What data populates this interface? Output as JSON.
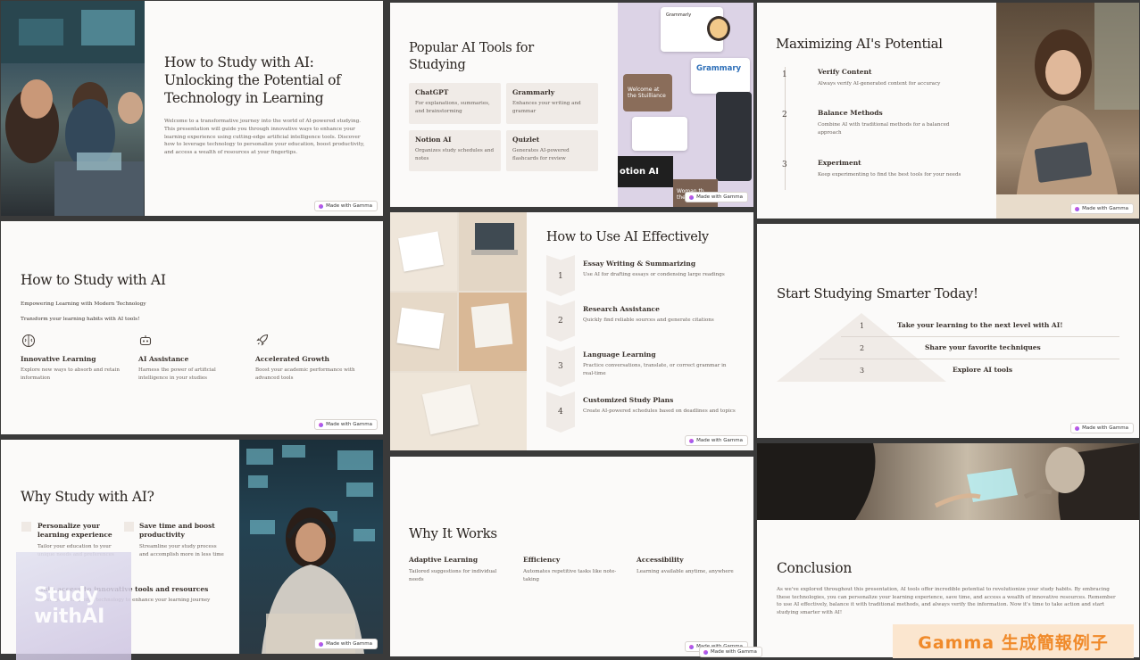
{
  "badge": "Made with Gamma",
  "slide1": {
    "title_lines": [
      "How to Study with AI:",
      "Unlocking the Potential of",
      "Technology in Learning"
    ],
    "body": "Welcome to a transformative journey into the world of AI-powered studying. This presentation will guide you through innovative ways to enhance your learning experience using cutting-edge artificial intelligence tools. Discover how to leverage technology to personalize your education, boost productivity, and access a wealth of resources at your fingertips."
  },
  "slide2": {
    "title": "Popular AI Tools for Studying",
    "tools": [
      {
        "name": "ChatGPT",
        "desc": "For explanations, summaries, and brainstorming"
      },
      {
        "name": "Grammarly",
        "desc": "Enhances your writing and grammar"
      },
      {
        "name": "Notion AI",
        "desc": "Organizes study schedules and notes"
      },
      {
        "name": "Quizlet",
        "desc": "Generates AI-powered flashcards for review"
      }
    ],
    "collage": {
      "grammarly_top": "Grammarly",
      "grammarly_main": "Grammary",
      "welcome": "Welcome at the Stuilliance",
      "notion": "otion AI",
      "woman": "Woman th the"
    }
  },
  "slide3": {
    "title": "Maximizing AI's Potential",
    "steps": [
      {
        "n": "1",
        "name": "Verify Content",
        "desc": "Always verify AI-generated content for accuracy"
      },
      {
        "n": "2",
        "name": "Balance Methods",
        "desc": "Combine AI with traditional methods for a balanced approach"
      },
      {
        "n": "3",
        "name": "Experiment",
        "desc": "Keep experimenting to find the best tools for your needs"
      }
    ]
  },
  "slide4": {
    "title": "How to Study with AI",
    "sub1": "Empowering Learning with Modern Technology",
    "sub2": "Transform your learning habits with AI tools!",
    "features": [
      {
        "name": "Innovative Learning",
        "desc": "Explore new ways to absorb and retain information",
        "icon": "brain-icon"
      },
      {
        "name": "AI Assistance",
        "desc": "Harness the power of artificial intelligence in your studies",
        "icon": "robot-icon"
      },
      {
        "name": "Accelerated Growth",
        "desc": "Boost your academic performance with advanced tools",
        "icon": "rocket-icon"
      }
    ]
  },
  "slide5": {
    "title": "How to Use AI Effectively",
    "steps": [
      {
        "n": "1",
        "name": "Essay Writing & Summarizing",
        "desc": "Use AI for drafting essays or condensing large readings"
      },
      {
        "n": "2",
        "name": "Research Assistance",
        "desc": "Quickly find reliable sources and generate citations"
      },
      {
        "n": "3",
        "name": "Language Learning",
        "desc": "Practice conversations, translate, or correct grammar in real-time"
      },
      {
        "n": "4",
        "name": "Customized Study Plans",
        "desc": "Create AI-powered schedules based on deadlines and topics"
      }
    ]
  },
  "slide6": {
    "title": "Start Studying Smarter Today!",
    "steps": [
      {
        "n": "1",
        "text": "Take your learning to the next level with AI!"
      },
      {
        "n": "2",
        "text": "Share your favorite techniques"
      },
      {
        "n": "3",
        "text": "Explore AI tools"
      }
    ]
  },
  "slide7": {
    "title": "Why Study with AI?",
    "items": [
      {
        "name": "Personalize your learning experience",
        "desc": "Tailor your education to your unique needs and preferences"
      },
      {
        "name": "Save time and boost productivity",
        "desc": "Streamline your study process and accomplish more in less time"
      },
      {
        "name": "Gain access to innovative tools and resources",
        "desc": "Leverage cutting-edge technology to enhance your learning journey"
      }
    ]
  },
  "slide8": {
    "title": "Why It Works",
    "cols": [
      {
        "name": "Adaptive Learning",
        "desc": "Tailored suggestions for individual needs"
      },
      {
        "name": "Efficiency",
        "desc": "Automates repetitive tasks like note-taking"
      },
      {
        "name": "Accessibility",
        "desc": "Learning available anytime, anywhere"
      }
    ]
  },
  "slide9": {
    "title": "Conclusion",
    "body": "As we've explored throughout this presentation, AI tools offer incredible potential to revolutionize your study habits. By embracing these technologies, you can personalize your learning experience, save time, and access a wealth of innovative resources. Remember to use AI effectively, balance it with traditional methods, and always verify the information. Now it's time to take action and start studying smarter with AI!"
  },
  "watermark_left": [
    "Study",
    "withAI"
  ],
  "watermark_right": "Gamma 生成簡報例子"
}
